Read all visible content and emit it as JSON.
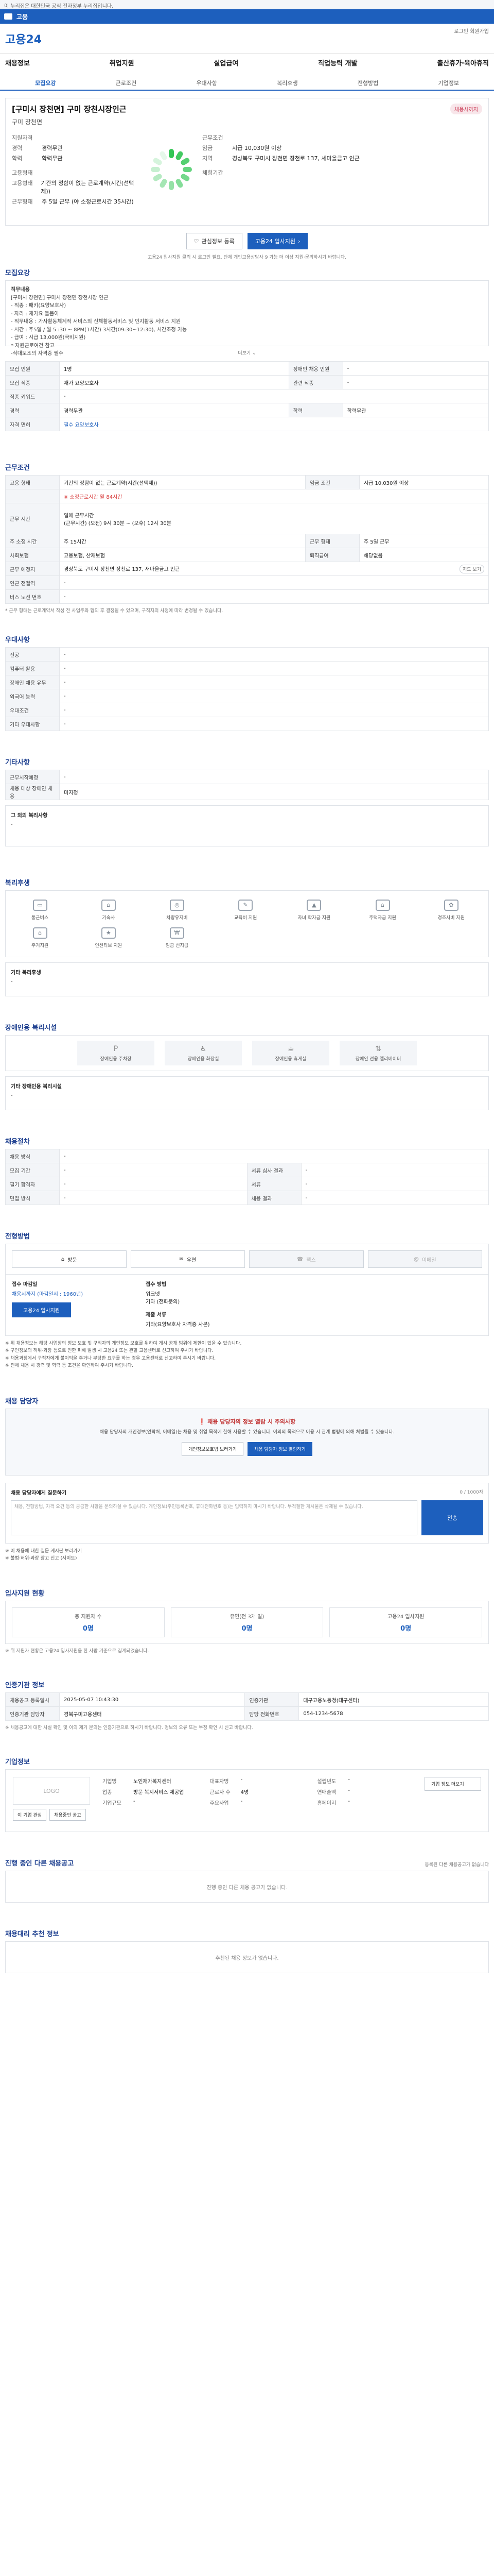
{
  "top_notice": "이 누리집은 대한민국 공식 전자정부 누리집입니다.",
  "govbar_text": "고용",
  "header": {
    "logo": "고용24",
    "top_right": "로그인 회원가입",
    "menu": [
      "채용정보",
      "취업지원",
      "실업급여",
      "직업능력 개발",
      "출산휴가·육아휴직"
    ]
  },
  "subnav": [
    "모집요강",
    "근로조건",
    "우대사항",
    "복리후생",
    "전형방법",
    "기업정보"
  ],
  "job": {
    "title": "[구미시 장천면] 구미 장천시장인근",
    "badge": "채용시까지",
    "company": "구미 장천면",
    "left": [
      {
        "k": "지원자격",
        "v": ""
      },
      {
        "k": "경력",
        "v": "경력무관"
      },
      {
        "k": "학력",
        "v": "학력무관"
      },
      {
        "k": "고용형태",
        "v": ""
      },
      {
        "k": "고용형태",
        "v": "기간의 정함이 없는 근로계약(시간(선택제))"
      },
      {
        "k": "근무형태",
        "v": "주 5일 근무 (야 소정근로시간 35시간)"
      }
    ],
    "right": [
      {
        "k": "근무조건",
        "v": ""
      },
      {
        "k": "임금",
        "v": "시급 10,030원 이상"
      },
      {
        "k": "지역",
        "v": "경상북도 구미시 장천면 장천로 137, 세마을금고 인근"
      },
      {
        "k": "체험기간",
        "v": ""
      }
    ],
    "btn_scrap": "관심정보 등록",
    "btn_apply": "고용24 입사지원",
    "note": "고용24 입사지원 클릭 시 로그인 필요. 단체 개인고용상담사 9 가능 더 이상 지원·문의하시기 바랍니다."
  },
  "recruit": {
    "section": "모집요강",
    "summary": [
      "직무내용",
      "[구미시 장천면] 구미시 장천면 장천시장 인근",
      "- 직종 : 패키(요양보호사)",
      "- 자리 : 재가요 돌봄이",
      "- 직무내용 : 가사활동체계적 서비스외 신체활동서비스 및 인지활동 서비스 지원",
      "- 시간 : 주5일 / 월 5 :30 ~ 8PM(1시간) 3시간(09:30~12:30), 시간조정 가능",
      "- 급여 : 시급 13,000원(국비지원)",
      "",
      "* 자원근로여건 참고",
      "-식대보조의 자격증 필수"
    ],
    "more": "더보기",
    "rows": [
      [
        {
          "k": "모집 인원",
          "v": "1명"
        },
        {
          "k": "장애인 채용 인원",
          "v": "-"
        }
      ],
      [
        {
          "k": "모집 직종",
          "v": "재가 요양보호사"
        },
        {
          "k": "관련 직종",
          "v": "-"
        }
      ],
      [
        {
          "k": "직종 키워드",
          "v": "-"
        },
        {
          "k": "",
          "v": ""
        }
      ],
      [
        {
          "k": "경력",
          "v": "경력무관"
        },
        {
          "k": "학력",
          "v": "학력무관"
        }
      ],
      [
        {
          "k": "자격 면허",
          "v": "필수 요양보호사"
        },
        {
          "k": "",
          "v": ""
        }
      ]
    ]
  },
  "work": {
    "section": "근무조건",
    "r1": {
      "k1": "고용 형태",
      "v1": "기간의 정함이 없는 근로계약(시간(선택제))",
      "k2": "임금 조건",
      "v2": "시급 10,030원 이상"
    },
    "r1b": "※ 소정근로시간 월 84시간",
    "r2": {
      "k": "근무 시간",
      "l1": "일에 근무시간",
      "l2": "(근무시간) (오전) 9시 30분 ~ (오후) 12시 30분"
    },
    "r3": {
      "k1": "주 소정 시간",
      "v1": "주 15시간",
      "k2": "근무 형태",
      "v2": "주 5일 근무"
    },
    "r4": {
      "k1": "사회보험",
      "v1": "고용보험, 산재보험",
      "k2": "퇴직급여",
      "v2": "해당없음"
    },
    "r5": {
      "k": "근무 예정지",
      "v": "경상북도 구미시 장천면 장천로 137, 새마을금고 인근",
      "btn": "지도 보기"
    },
    "r6": {
      "k": "인근 전철역",
      "v": "-"
    },
    "r7": {
      "k": "버스 노선 번호",
      "v": "-"
    },
    "foot": "* 근무 형태는 근로계약서 작성 전 사업주와 협의 후 결정될 수 있으며, 구직자의 사정에 따라 변경될 수 있습니다."
  },
  "pref": {
    "section": "우대사항",
    "rows": [
      {
        "k": "전공",
        "v": "-"
      },
      {
        "k": "컴퓨터 활용",
        "v": "-"
      },
      {
        "k": "장애인 채용 유무",
        "v": "-"
      },
      {
        "k": "외국어 능력",
        "v": "-"
      },
      {
        "k": "우대조건",
        "v": "-"
      },
      {
        "k": "기타 우대사항",
        "v": "-"
      }
    ]
  },
  "etc": {
    "section": "기타사항",
    "rows": [
      {
        "k": "근무시작예정",
        "v": "-"
      },
      {
        "k": "채용 대상 장애인 채용",
        "v": "미지정"
      }
    ],
    "box_label": "그 외의 복리사항",
    "box_value": "-"
  },
  "benefits": {
    "section": "복리후생",
    "items": [
      "통근버스",
      "기숙사",
      "차량유지비",
      "교육비 지원",
      "자녀 학자금 지원",
      "주택자금 지원",
      "경조사비 지원",
      "주거지원",
      "인센티브 지원",
      "임금 선지급"
    ],
    "icons": [
      "bus-icon",
      "dorm-icon",
      "car-icon",
      "education-icon",
      "graduation-icon",
      "home-icon",
      "gift-icon",
      "house-icon",
      "incentive-icon",
      "wage-icon"
    ],
    "other_label": "기타 복리후생",
    "other_value": "-"
  },
  "disabled": {
    "section": "장애인용 복리시설",
    "items": [
      "장애인용 주차장",
      "장애인용 화장실",
      "장애인용 휴게실",
      "장애인 전용 엘리베이터"
    ],
    "other_label": "기타 장애인용 복리시설",
    "other_value": "-"
  },
  "hiring": {
    "section": "채용절차",
    "rows": [
      [
        {
          "k": "채용 방식",
          "v": "-"
        },
        {
          "k": "",
          "v": ""
        }
      ],
      [
        {
          "k": "모집 기간",
          "v": "-"
        },
        {
          "k": "서류 심사 결과",
          "v": "-"
        }
      ],
      [
        {
          "k": "필기 합격자",
          "v": "-"
        },
        {
          "k": "서류",
          "v": "-"
        }
      ],
      [
        {
          "k": "면접 방식",
          "v": "-"
        },
        {
          "k": "채용 결과",
          "v": "-"
        }
      ]
    ]
  },
  "method": {
    "section": "전형방법",
    "tabs": [
      "방문",
      "우편",
      "팩스",
      "이메일"
    ],
    "tab_icons": [
      "visit-icon",
      "mail-icon",
      "fax-icon",
      "email-icon"
    ],
    "l_title": "접수 마감일",
    "l_value": "채용시까지 (마감일시 : 1960년)",
    "l_btn": "고용24 입사지원",
    "r_title1": "접수 방법",
    "r_v1": "워크넷",
    "r_v2": "기타 (전화문의)",
    "r_title2": "제출 서류",
    "r_v3": "기타(요양보호사 자격증 사본)",
    "bullets": [
      "※ 위 채용정보는 해당 사업장의 정보 보호 및 구직자의 개인정보 보호를 위하여 게시·공개 범위에 제한이 있을 수 있습니다.",
      "※ 구인정보의 허위·과장 등으로 인한 피해 발생 시 고용24 또는 관할 고용센터로 신고하여 주시기 바랍니다.",
      "※ 채용과정에서 구직자에게 불이익을 주거나 부당한 요구를 하는 경우 고용센터로 신고하여 주시기 바랍니다.",
      "※ 전체 채용 시 경력 및 학력 등 조건을 확인하여 주시기 바랍니다."
    ]
  },
  "contact": {
    "section": "채용 담당자",
    "alert_title": "채용 담당자의 정보 열람 시 주의사항",
    "alert_text": "채용 담당자의 개인정보(연락처, 이메일)는 채용 및 취업 목적에 한해 사용할 수 있습니다. 이외의 목적으로 이용 시 관계 법령에 의해 처벌될 수 있습니다.",
    "btn1": "개인정보보호법 보러가기",
    "btn2": "채용 담당자 정보 열람하기",
    "qa_label": "채용 담당자에게 질문하기",
    "qa_count": "0 / 1000자",
    "qa_placeholder": "채용, 전형방법, 자격 요건 등의 궁금한 사항을 문의하실 수 있습니다. 개인정보(주민등록번호, 휴대전화번호 등)는 입력하지 마시기 바랍니다. 부적절한 게시물은 삭제될 수 있습니다.",
    "qa_btn": "전송",
    "notes": [
      "※ 이 채용에 대한 질문 게시판 보러가기",
      "※ 불법·허위·과장 광고 신고 (사이트)"
    ]
  },
  "apply_status": {
    "section": "입사지원 현황",
    "stats": [
      {
        "l": "총 지원자 수",
        "v": "0명"
      },
      {
        "l": "유연(전 3개 일)",
        "v": "0명"
      },
      {
        "l": "고용24 입사지원",
        "v": "0명"
      }
    ],
    "foot": "※ 위 지원자 현황은 고용24 입사지원을 한 사람 기준으로 집계되었습니다."
  },
  "info": {
    "section": "인증기관 정보",
    "rows": [
      [
        {
          "k": "채용공고 등록일시",
          "v": "2025-05-07 10:43:30"
        },
        {
          "k": "인증기관",
          "v": "대구고용노동청(대구센터)"
        }
      ],
      [
        {
          "k": "인증기관 담당자",
          "v": "경북구미고용센터"
        },
        {
          "k": "담당 전화번호",
          "v": "054-1234-5678"
        }
      ]
    ],
    "foot": "※ 채용공고에 대한 사실 확인 및 이의 제기 문의는 인증기관으로 하시기 바랍니다. 정보의 오류 또는 부정 확인 시 신고 바랍니다."
  },
  "corp": {
    "section": "기업정보",
    "logo": "LOGO",
    "btn1": "이 기업 관심",
    "btn2": "채용중인 공고",
    "c1": [
      {
        "k": "기업명",
        "v": "노인재가복지센터"
      },
      {
        "k": "업종",
        "v": "방문 복지서비스 제공업"
      },
      {
        "k": "기업규모",
        "v": "-"
      }
    ],
    "c2": [
      {
        "k": "대표자명",
        "v": "-"
      },
      {
        "k": "근로자 수",
        "v": "4명"
      },
      {
        "k": "주요사업",
        "v": "-"
      }
    ],
    "c3": [
      {
        "k": "설립년도",
        "v": "-"
      },
      {
        "k": "연매출액",
        "v": "-"
      },
      {
        "k": "홈페이지",
        "v": "-"
      }
    ],
    "btn_more": "기업 정보 더보기"
  },
  "other_jobs": {
    "section": "진행 중인 다른 채용공고",
    "right": "등록된 다른 채용공고가 없습니다",
    "empty": "진행 중인 다른 채용 공고가 없습니다."
  },
  "agency": {
    "section": "채용대리 추천 정보",
    "empty": "추천된 채용 정보가 없습니다."
  }
}
